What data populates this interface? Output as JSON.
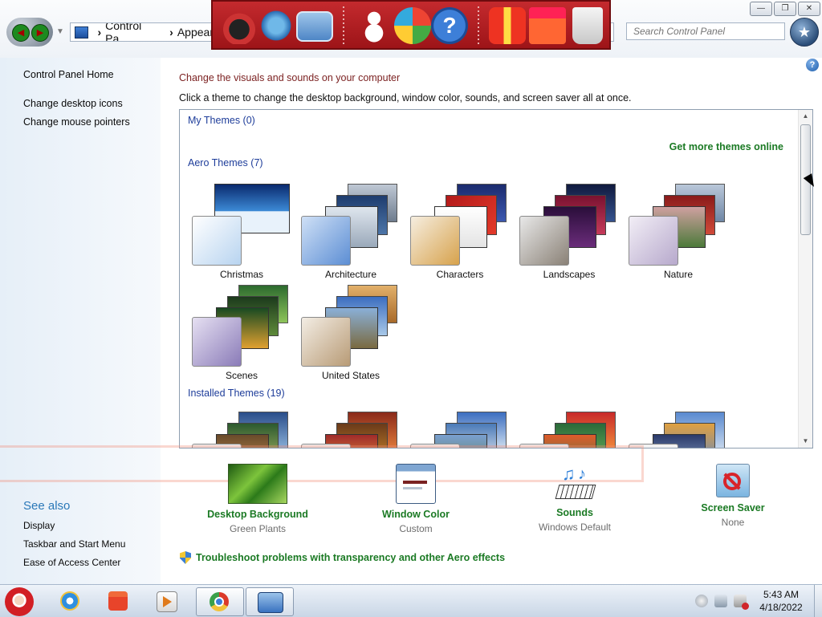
{
  "window": {
    "address_parts": [
      "Control Pa...",
      "Appear"
    ],
    "search_placeholder": "Search Control Panel",
    "controls": [
      "minimize",
      "restore",
      "close"
    ]
  },
  "launch_bar": {
    "icons": [
      "desktop-icon",
      "globe-icon",
      "network-icon",
      "snowman-icon",
      "shield-icon",
      "help-icon",
      "gift-icon",
      "folder-icon",
      "recycle-bin-icon"
    ]
  },
  "sidebar": {
    "home": "Control Panel Home",
    "links": [
      "Change desktop icons",
      "Change mouse pointers"
    ],
    "see_also_title": "See also",
    "see_also": [
      "Display",
      "Taskbar and Start Menu",
      "Ease of Access Center"
    ]
  },
  "main": {
    "heading": "Change the visuals and sounds on your computer",
    "description": "Click a theme to change the desktop background, window color, sounds, and screen saver all at once.",
    "get_more": "Get more themes online",
    "sections": {
      "my": "My Themes (0)",
      "aero": "Aero Themes (7)",
      "installed": "Installed Themes (19)"
    },
    "aero_themes": [
      {
        "name": "Christmas",
        "accent": "#2f6fc0"
      },
      {
        "name": "Architecture",
        "accent": "#4f7ec4"
      },
      {
        "name": "Characters",
        "accent": "#d9a24a"
      },
      {
        "name": "Landscapes",
        "accent": "#7b6a5a"
      },
      {
        "name": "Nature",
        "accent": "#b0a4c4"
      },
      {
        "name": "Scenes",
        "accent": "#8e7fb5"
      },
      {
        "name": "United States",
        "accent": "#b79b78"
      }
    ]
  },
  "settings": [
    {
      "title": "Desktop Background",
      "value": "Green Plants",
      "icon": "desktop-background-icon"
    },
    {
      "title": "Window Color",
      "value": "Custom",
      "icon": "window-color-icon"
    },
    {
      "title": "Sounds",
      "value": "Windows Default",
      "icon": "sounds-icon"
    },
    {
      "title": "Screen Saver",
      "value": "None",
      "icon": "screen-saver-icon"
    }
  ],
  "troubleshoot": "Troubleshoot problems with transparency and other Aero effects",
  "taskbar": {
    "apps": [
      "santa-start-icon",
      "internet-explorer-icon",
      "file-explorer-icon",
      "media-player-icon",
      "chrome-icon",
      "control-panel-icon"
    ],
    "time": "5:43 AM",
    "date": "4/18/2022"
  }
}
